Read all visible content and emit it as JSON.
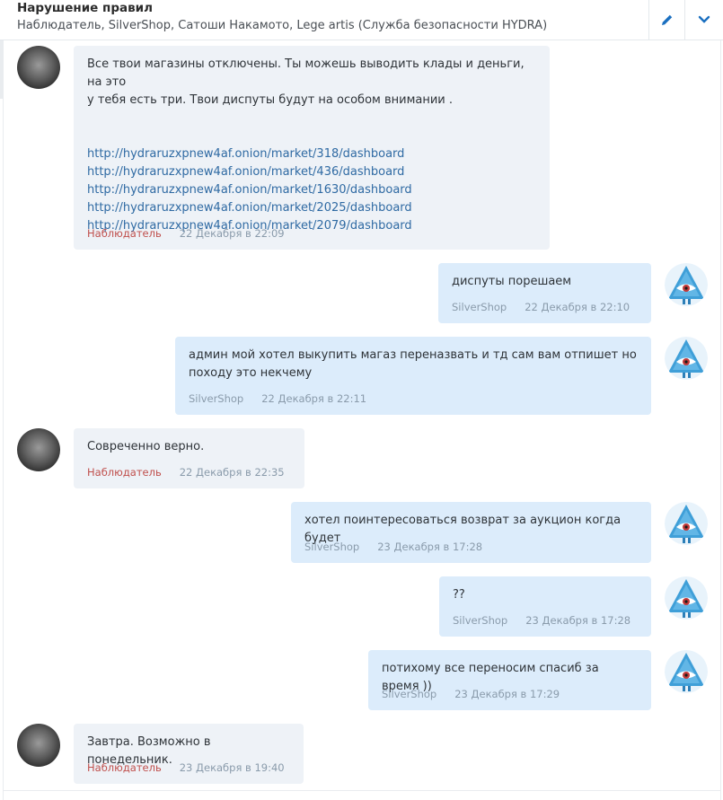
{
  "conversation": {
    "title": "Нарушение правил",
    "participants": "Наблюдатель, SilverShop, Сатоши Накамото, Lege artis (Служба безопасности HYDRA)"
  },
  "header_icons": {
    "edit": "pencil-icon",
    "toggle": "chevron-down-icon"
  },
  "colors": {
    "incoming_bubble": "#eef2f7",
    "outgoing_bubble": "#dcecfb",
    "link": "#2f6aa3",
    "observer_name": "#c0504d",
    "meta": "#8a9bab"
  },
  "messages": [
    {
      "author": "Наблюдатель",
      "lines": [
        "Все твои магазины отключены. Ты можешь выводить клады и деньги, на это",
        "у тебя есть три. Твои диспуты будут на особом внимании ."
      ],
      "links": [
        "http://hydraruzxpnew4af.onion/market/318/dashboard",
        "http://hydraruzxpnew4af.onion/market/436/dashboard",
        "http://hydraruzxpnew4af.onion/market/1630/dashboard",
        "http://hydraruzxpnew4af.onion/market/2025/dashboard",
        "http://hydraruzxpnew4af.onion/market/2079/dashboard"
      ],
      "time": "22 Декабря в 22:09"
    },
    {
      "author": "SilverShop",
      "lines": [
        "диспуты порешаем"
      ],
      "time": "22 Декабря в 22:10"
    },
    {
      "author": "SilverShop",
      "lines": [
        "админ мой хотел выкупить магаз переназвать и тд сам вам отпишет но",
        "походу это некчему"
      ],
      "time": "22 Декабря в 22:11"
    },
    {
      "author": "Наблюдатель",
      "lines": [
        "Совреченно верно."
      ],
      "time": "22 Декабря в 22:35"
    },
    {
      "author": "SilverShop",
      "lines": [
        "хотел поинтересоваться возврат за аукцион когда будет"
      ],
      "time": "23 Декабря в 17:28"
    },
    {
      "author": "SilverShop",
      "lines": [
        "??"
      ],
      "time": "23 Декабря в 17:28"
    },
    {
      "author": "SilverShop",
      "lines": [
        "потихому все переносим спасиб за время ))"
      ],
      "time": "23 Декабря в 17:29"
    },
    {
      "author": "Наблюдатель",
      "lines": [
        "Завтра. Возможно в понедельник."
      ],
      "time": "23 Декабря в 19:40"
    }
  ]
}
